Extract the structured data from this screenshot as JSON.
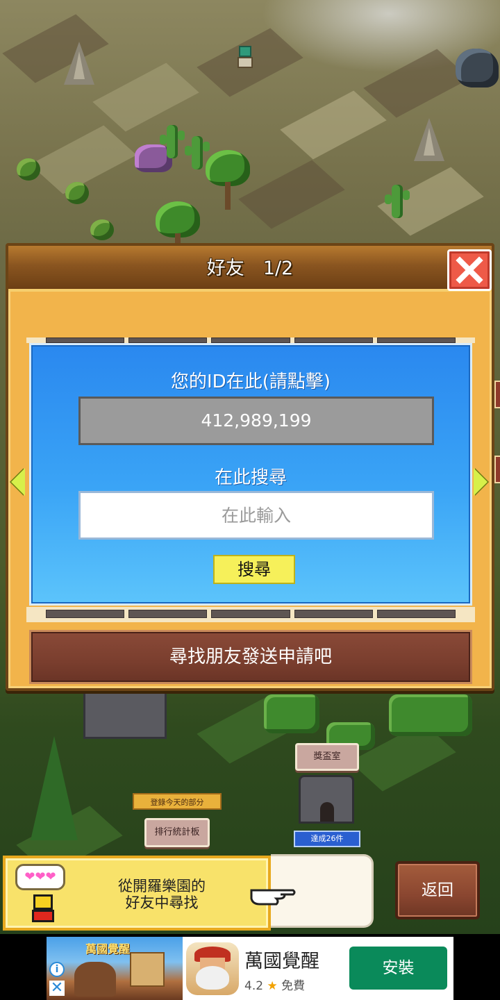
{
  "dialog": {
    "title": "好友　1/2",
    "id_label": "您的ID在此(請點擊)",
    "id_value": "412,989,199",
    "search_label": "在此搜尋",
    "search_placeholder": "在此輸入",
    "search_button": "搜尋",
    "hint": "尋找朋友發送申請吧"
  },
  "world": {
    "trophy_room": "獎盃室",
    "login_today": "登錄今天的部分",
    "ranking_board": "排行統計板",
    "achievements": "達成26件"
  },
  "info_panel": {
    "hearts": "❤❤❤",
    "line1": "從開羅樂園的",
    "line2": "好友中尋找"
  },
  "back_button": "返回",
  "ad": {
    "art_title": "萬國覺醒",
    "app_name": "萬國覺醒",
    "rating": "4.2",
    "star": "★",
    "price": "免費",
    "install": "安裝",
    "info_glyph": "i",
    "close_glyph": "✕"
  },
  "icons": {
    "close": "close-icon",
    "prev": "arrow-left-icon",
    "next": "arrow-right-icon",
    "pointer": "pointing-hand-icon"
  },
  "colors": {
    "dialog_bg": "#f2b44b",
    "panel_blue": "#2a88ef",
    "close_red": "#ee5a48",
    "search_button": "#f6f05a",
    "install_green": "#0a8a5a"
  }
}
